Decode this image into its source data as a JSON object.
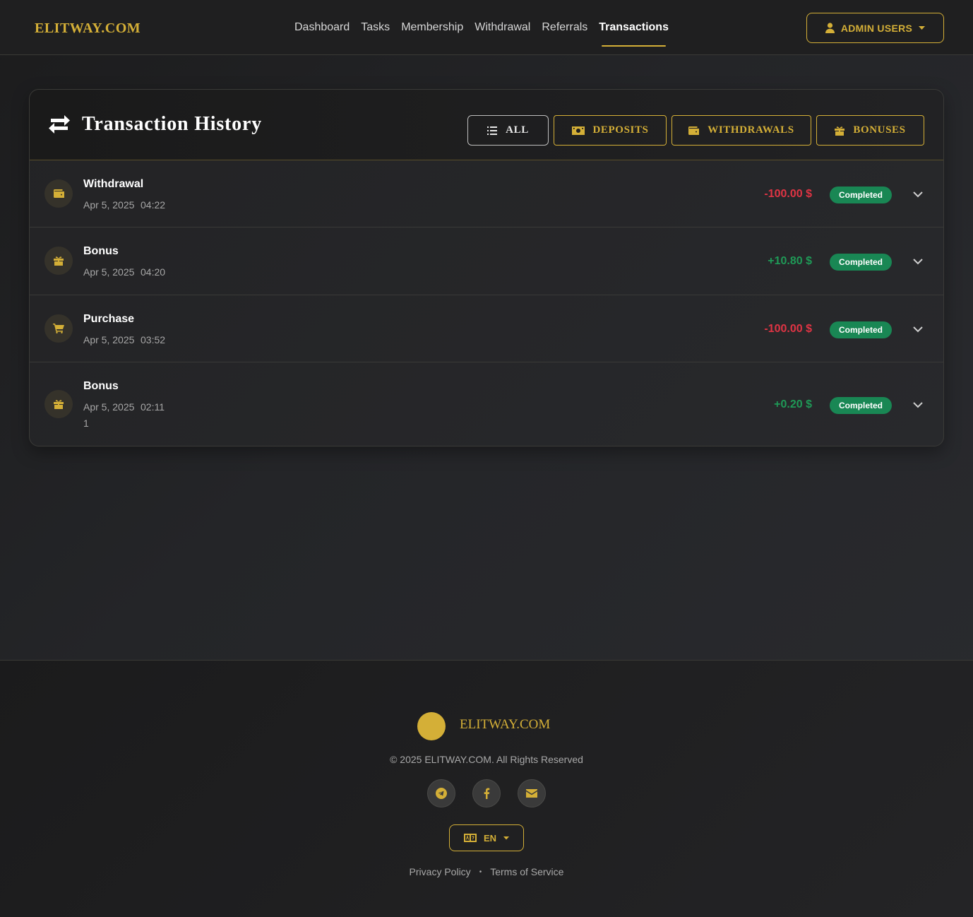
{
  "header": {
    "brand": "ELITWAY.COM",
    "nav": [
      {
        "label": "Dashboard",
        "active": false
      },
      {
        "label": "Tasks",
        "active": false
      },
      {
        "label": "Membership",
        "active": false
      },
      {
        "label": "Withdrawal",
        "active": false
      },
      {
        "label": "Referrals",
        "active": false
      },
      {
        "label": "Transactions",
        "active": true
      }
    ],
    "admin_button": "ADMIN USERS",
    "admin_icon": "user-icon"
  },
  "history": {
    "title": "Transaction History",
    "title_icon": "exchange-arrows-icon",
    "filters": [
      {
        "label": "ALL",
        "icon": "list-icon",
        "active": true
      },
      {
        "label": "DEPOSITS",
        "icon": "money-bill-icon",
        "active": false
      },
      {
        "label": "WITHDRAWALS",
        "icon": "wallet-icon",
        "active": false
      },
      {
        "label": "BONUSES",
        "icon": "gift-icon",
        "active": false
      }
    ],
    "transactions": [
      {
        "type": "Withdrawal",
        "icon": "wallet-icon",
        "date": "Apr 5, 2025",
        "time": "04:22",
        "note": "",
        "amount": "-100.00 $",
        "direction": "negative",
        "status": "Completed"
      },
      {
        "type": "Bonus",
        "icon": "gift-icon",
        "date": "Apr 5, 2025",
        "time": "04:20",
        "note": "",
        "amount": "+10.80 $",
        "direction": "positive",
        "status": "Completed"
      },
      {
        "type": "Purchase",
        "icon": "cart-icon",
        "date": "Apr 5, 2025",
        "time": "03:52",
        "note": "",
        "amount": "-100.00 $",
        "direction": "negative",
        "status": "Completed"
      },
      {
        "type": "Bonus",
        "icon": "gift-icon",
        "date": "Apr 5, 2025",
        "time": "02:11",
        "note": "1",
        "amount": "+0.20 $",
        "direction": "positive",
        "status": "Completed"
      }
    ]
  },
  "footer": {
    "brand": "ELITWAY.COM",
    "copyright": "© 2025 ELITWAY.COM. All Rights Reserved",
    "social": [
      {
        "icon": "telegram-icon"
      },
      {
        "icon": "facebook-icon"
      },
      {
        "icon": "envelope-icon"
      }
    ],
    "language": "EN",
    "links": [
      "Privacy Policy",
      "Terms of Service"
    ]
  },
  "colors": {
    "accent": "#d4af37",
    "negative": "#e03444",
    "positive": "#1f9a57",
    "badge": "#198754",
    "background": "#242528"
  }
}
